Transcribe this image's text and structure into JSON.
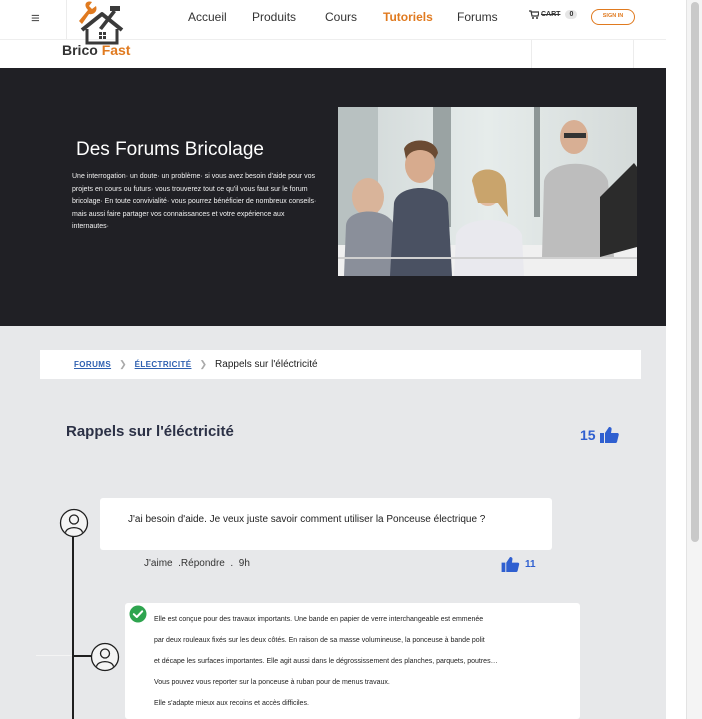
{
  "brand": {
    "name_part1": "Brico",
    "name_part2": "Fast"
  },
  "nav": {
    "items": [
      "Accueil",
      "Produits",
      "Cours",
      "Tutoriels",
      "Forums"
    ],
    "active": "Tutoriels",
    "cart_label": "CART",
    "cart_count": "0",
    "signin_label": "SIGN IN"
  },
  "hero": {
    "title": "Des Forums  Bricolage",
    "description": "Une interrogation· un doute· un problème· si vous avez besoin d'aide pour vos projets en cours ou futurs· vous trouverez tout ce qu'il vous faut sur le forum bricolage· En toute convivialité· vous pourrez bénéficier de nombreux conseils· mais aussi faire partager vos connaissances et votre expérience aux internautes·"
  },
  "breadcrumb": {
    "items": [
      "FORUMS",
      "ÉLECTRICITÉ"
    ],
    "current": "Rappels sur l'éléctricité"
  },
  "topic": {
    "title": "Rappels sur l'éléctricité",
    "likes": "15"
  },
  "comment": {
    "text": "J'ai besoin d'aide. Je veux juste savoir comment utiliser la Ponceuse électrique ?",
    "like_label": "J'aime",
    "reply_label": ".Répondre",
    "sep": ".",
    "time": "9h",
    "likes": "11"
  },
  "answer": {
    "lines": [
      "Elle est conçue pour des travaux importants. Une bande en papier de verre interchangeable est emmenée",
      "par deux rouleaux fixés sur les deux côtés. En raison de sa masse volumineuse, la ponceuse à bande polit",
      "et décape les surfaces importantes. Elle agit aussi dans le dégrossissement des planches, parquets, poutres…",
      " Vous pouvez vous reporter sur la ponceuse à ruban pour de menus travaux.",
      "Elle s'adapte mieux aux recoins et accès difficiles."
    ]
  },
  "colors": {
    "accent": "#e07a1f",
    "link": "#2d5fb0",
    "like": "#2f5fd0",
    "hero_bg": "#202025",
    "content_bg": "#e7e8ea",
    "check": "#2ea44f"
  },
  "icons": [
    "menu-icon",
    "logo-icon",
    "cart-icon",
    "thumbs-up-icon",
    "user-avatar-icon",
    "check-circle-icon"
  ]
}
